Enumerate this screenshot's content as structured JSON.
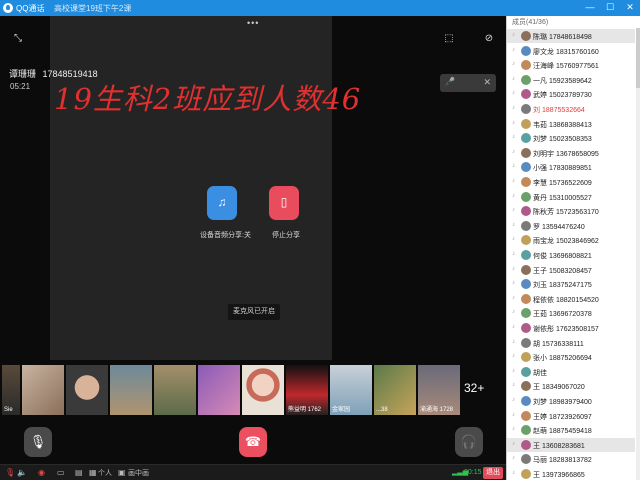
{
  "titlebar": {
    "title": "QQ通话",
    "subtitle": "高校课堂19班下午2课",
    "minimize": "—",
    "maximize": "☐",
    "close": "✕"
  },
  "call": {
    "caller_name": "谭珊珊",
    "caller_phone": "17848519418",
    "duration": "05:21",
    "overlay_text": "19生科2班应到人数46",
    "audio_share_label": "设备音频分享:关",
    "stop_share_label": "停止分享",
    "mic_toast": "麦克风已开启",
    "more_count": "32+"
  },
  "strip": [
    {
      "caption": "Sie"
    },
    {
      "caption": ""
    },
    {
      "caption": ""
    },
    {
      "caption": ""
    },
    {
      "caption": ""
    },
    {
      "caption": ""
    },
    {
      "caption": ""
    },
    {
      "caption": "熊益明 1762"
    },
    {
      "caption": "金家园"
    },
    {
      "caption": "...38"
    },
    {
      "caption": "渝通海 1728"
    }
  ],
  "toolbar": {
    "view_label": "个人",
    "layout_label": "画中画",
    "timer": "00:15",
    "exit_label": "退出"
  },
  "members": {
    "header": "成员(41/36)",
    "list": [
      {
        "name": "陈璐 17848618498"
      },
      {
        "name": "廖文龙 18315760160"
      },
      {
        "name": "汪海峰 15760977561"
      },
      {
        "name": "一凡 15923589642"
      },
      {
        "name": "武婷 15023789730"
      },
      {
        "name": "刘 18875532664"
      },
      {
        "name": "韦茹 13868388413"
      },
      {
        "name": "刘梦 15023508353"
      },
      {
        "name": "刘明宇 13678658095"
      },
      {
        "name": "小强 17830889851"
      },
      {
        "name": "李慧 15736522609"
      },
      {
        "name": "黄丹 15310005527"
      },
      {
        "name": "陈秋芳 15723563170"
      },
      {
        "name": "罗 13594476240"
      },
      {
        "name": "雨宝龙 15023846962"
      },
      {
        "name": "何俊 13696808821"
      },
      {
        "name": "王子 15083208457"
      },
      {
        "name": "刘玉 18375247175"
      },
      {
        "name": "程依依 18820154520"
      },
      {
        "name": "王茹 13696720378"
      },
      {
        "name": "谢依彤 17623508157"
      },
      {
        "name": "胡 15736338111"
      },
      {
        "name": "张小 18875206694"
      },
      {
        "name": "胡佳"
      },
      {
        "name": "王 18349067020"
      },
      {
        "name": "刘梦 18983979400"
      },
      {
        "name": "王婷 18723926097"
      },
      {
        "name": "赵萌 18875459418"
      },
      {
        "name": "王 13608283681"
      },
      {
        "name": "马丽 18283813782"
      },
      {
        "name": "王 13973966865"
      }
    ]
  },
  "colors": {
    "titlebar": "#1f8ce0",
    "hangup": "#ec4f5f",
    "audio_share": "#3a8fe3",
    "overlay_text": "#e03030",
    "exit": "#e24c5a"
  }
}
